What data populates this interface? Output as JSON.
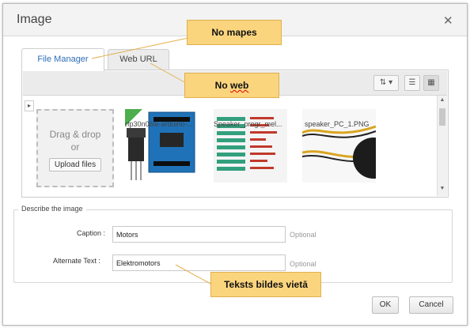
{
  "dialog": {
    "title": "Image",
    "close_icon": "close-icon"
  },
  "tabs": [
    {
      "label": "File Manager",
      "active": true
    },
    {
      "label": "Web URL",
      "active": false
    }
  ],
  "toolbar": {
    "sort_icon": "sort-icon",
    "list_icon": "list-view-icon",
    "grid_icon": "grid-view-icon"
  },
  "dropzone": {
    "line1": "Drag & drop",
    "line2": "or",
    "upload_label": "Upload files"
  },
  "files": [
    {
      "name": "rfp30n06le-arduino-...",
      "icon": "arduino-board-image"
    },
    {
      "name": "Speaker_progr_mel...",
      "icon": "code-screenshot-image"
    },
    {
      "name": "speaker_PC_1.PNG",
      "icon": "speaker-wires-image"
    }
  ],
  "describe": {
    "legend": "Describe the image",
    "caption_label": "Caption :",
    "caption_value": "Motors",
    "alt_label": "Alternate Text :",
    "alt_value": "Elektromotors",
    "optional": "Optional"
  },
  "buttons": {
    "ok": "OK",
    "cancel": "Cancel"
  },
  "annotations": {
    "no_mapes": "No mapes",
    "no": "No",
    "web": "web",
    "teksts": "Teksts bildes vietā"
  },
  "colors": {
    "annotation_bg": "#fbd57e",
    "accent": "#2e6eb5"
  }
}
